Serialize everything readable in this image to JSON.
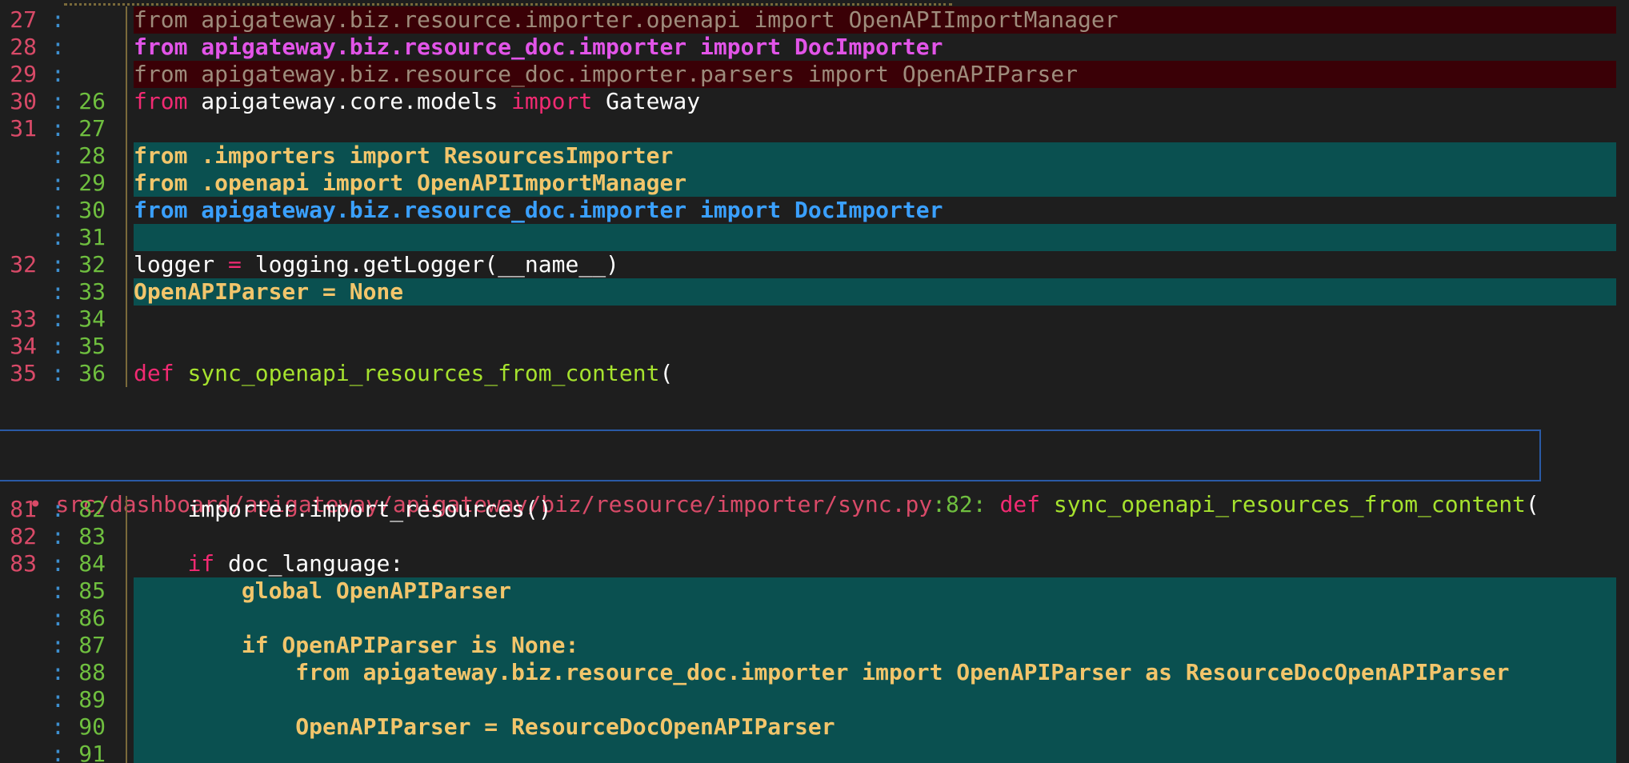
{
  "hunk1": {
    "rows": [
      {
        "old": "27",
        "new": "",
        "kind": "removed",
        "text": "from apigateway.biz.resource.importer.openapi import OpenAPIImportManager"
      },
      {
        "old": "28",
        "new": "",
        "kind": "magenta",
        "text": "from apigateway.biz.resource_doc.importer import DocImporter"
      },
      {
        "old": "29",
        "new": "",
        "kind": "removed",
        "text": "from apigateway.biz.resource_doc.importer.parsers import OpenAPIParser"
      },
      {
        "old": "30",
        "new": "26",
        "kind": "plain",
        "text": "from apigateway.core.models import Gateway"
      },
      {
        "old": "31",
        "new": "27",
        "kind": "plain",
        "text": ""
      },
      {
        "old": "",
        "new": "28",
        "kind": "added",
        "text": "from .importers import ResourcesImporter"
      },
      {
        "old": "",
        "new": "29",
        "kind": "added",
        "text": "from .openapi import OpenAPIImportManager"
      },
      {
        "old": "",
        "new": "30",
        "kind": "moved",
        "text": "from apigateway.biz.resource_doc.importer import DocImporter"
      },
      {
        "old": "",
        "new": "31",
        "kind": "added",
        "text": ""
      },
      {
        "old": "32",
        "new": "32",
        "kind": "plain",
        "text": "logger = logging.getLogger(__name__)"
      },
      {
        "old": "",
        "new": "33",
        "kind": "added",
        "text": "OpenAPIParser = None"
      },
      {
        "old": "33",
        "new": "34",
        "kind": "plain",
        "text": ""
      },
      {
        "old": "34",
        "new": "35",
        "kind": "plain",
        "text": ""
      },
      {
        "old": "35",
        "new": "36",
        "kind": "plain",
        "text": "def sync_openapi_resources_from_content("
      }
    ]
  },
  "file_header": {
    "bullet": "•",
    "path": "src/dashboard/apigateway/apigateway/biz/resource/importer/sync.py",
    "line": ":82:",
    "keyword": "def",
    "func": "sync_openapi_resources_from_content",
    "rest": "("
  },
  "hunk2": {
    "rows": [
      {
        "old": "81",
        "new": "82",
        "kind": "plain",
        "text": "    importer.import_resources()"
      },
      {
        "old": "82",
        "new": "83",
        "kind": "plain",
        "text": ""
      },
      {
        "old": "83",
        "new": "84",
        "kind": "plain",
        "text": "    if doc_language:"
      },
      {
        "old": "",
        "new": "85",
        "kind": "added",
        "text": "        global OpenAPIParser"
      },
      {
        "old": "",
        "new": "86",
        "kind": "added",
        "text": ""
      },
      {
        "old": "",
        "new": "87",
        "kind": "added",
        "text": "        if OpenAPIParser is None:"
      },
      {
        "old": "",
        "new": "88",
        "kind": "added",
        "text": "            from apigateway.biz.resource_doc.importer import OpenAPIParser as ResourceDocOpenAPIParser"
      },
      {
        "old": "",
        "new": "89",
        "kind": "added",
        "text": ""
      },
      {
        "old": "",
        "new": "90",
        "kind": "added",
        "text": "            OpenAPIParser = ResourceDocOpenAPIParser"
      },
      {
        "old": "",
        "new": "91",
        "kind": "added",
        "text": ""
      }
    ]
  },
  "colors": {
    "background": "#1e1e1e",
    "removed_bg": "#3a0006",
    "added_bg": "#0a5050",
    "added_fg": "#f2c56b",
    "keyword": "#f12a72",
    "function": "#a6e22e",
    "old_lineno": "#d94a68",
    "new_lineno": "#6fbf3f",
    "moved_fg": "#3aa0ff",
    "magenta_fg": "#e254e8",
    "header_border": "#2a5aa6"
  },
  "separator": ":"
}
